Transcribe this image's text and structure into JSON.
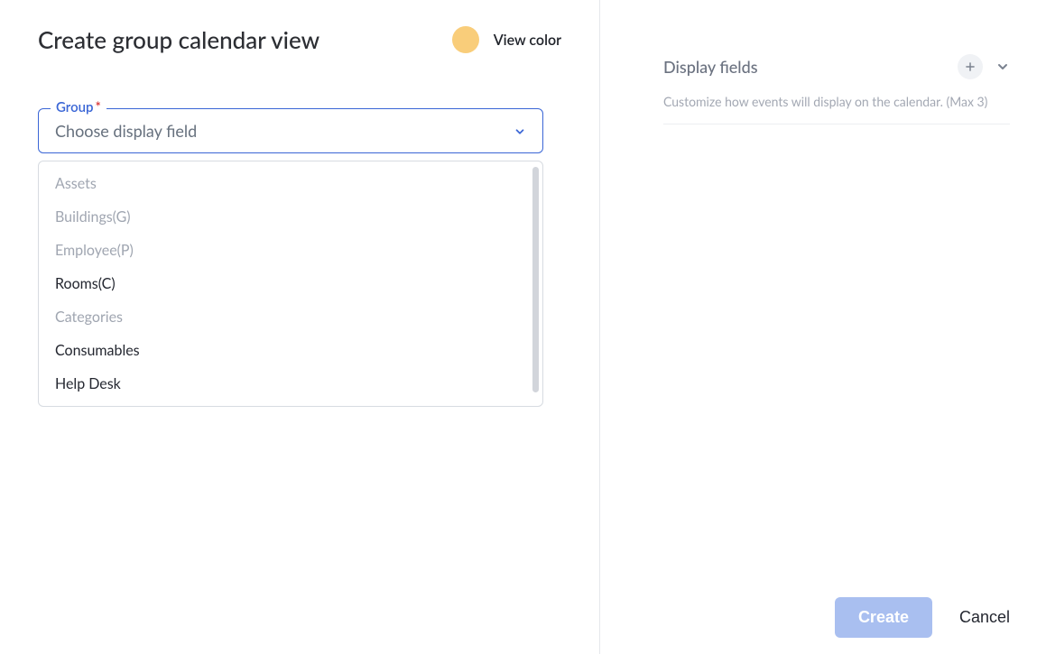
{
  "header": {
    "title": "Create group calendar view",
    "view_color_label": "View color",
    "swatch_color": "#f9cd7a"
  },
  "group_field": {
    "legend": "Group",
    "required_mark": "*",
    "placeholder": "Choose display field",
    "options": [
      {
        "label": "Assets",
        "enabled": false
      },
      {
        "label": "Buildings(G)",
        "enabled": false
      },
      {
        "label": "Employee(P)",
        "enabled": false
      },
      {
        "label": "Rooms(C)",
        "enabled": true
      },
      {
        "label": "Categories",
        "enabled": false
      },
      {
        "label": "Consumables",
        "enabled": true
      },
      {
        "label": "Help Desk",
        "enabled": true
      }
    ]
  },
  "right": {
    "title": "Display fields",
    "subtitle": "Customize how events will display on the calendar. (Max 3)"
  },
  "footer": {
    "create": "Create",
    "cancel": "Cancel"
  },
  "icons": {
    "chevron_color": "#3a66d6",
    "right_chevron_color": "#7a828f",
    "plus_color": "#7a828f"
  }
}
